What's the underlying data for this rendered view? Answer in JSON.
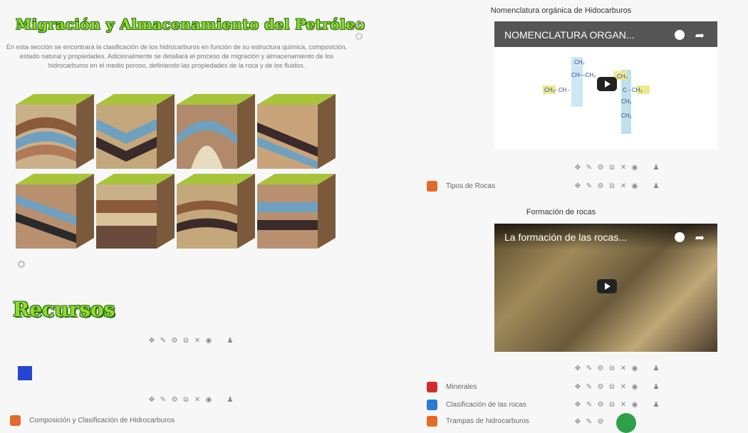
{
  "left": {
    "title": "Migración y Almacenamiento del Petróleo",
    "intro": "En esta sección se encontrará la clasificación de los hidrocarburos en función de su estructura química, composición, estado natural y propiedades. Adicionalmente se detallará el proceso de migración y almacenamiento de los hidrocarburos en el medio poroso, definiendo las propiedades de la roca y de los fluidos.",
    "recursos_heading": "Recursos",
    "resource_label": "Composición y Clasificación de Hidrocarburos"
  },
  "right": {
    "video1": {
      "title": "Nomenclatura orgánica de Hidocarburos",
      "overlay": "NOMENCLATURA ORGAN..."
    },
    "rocas_label": "Tipos de Rocas",
    "video2": {
      "title": "Formación de rocas",
      "overlay": "La formación de las rocas..."
    },
    "resources": [
      {
        "label": "Minerales",
        "color": "#d42a2a"
      },
      {
        "label": "Clasificación de las rocas",
        "color": "#2a7bd4"
      },
      {
        "label": "Trampas de hidrocarburos",
        "color": "#e26a2a"
      }
    ]
  },
  "toolbar_icons": [
    "move-icon",
    "edit-icon",
    "gear-icon",
    "copy-icon",
    "delete-icon",
    "eye-icon",
    "user-icon"
  ],
  "accent": "#8fdc2a"
}
